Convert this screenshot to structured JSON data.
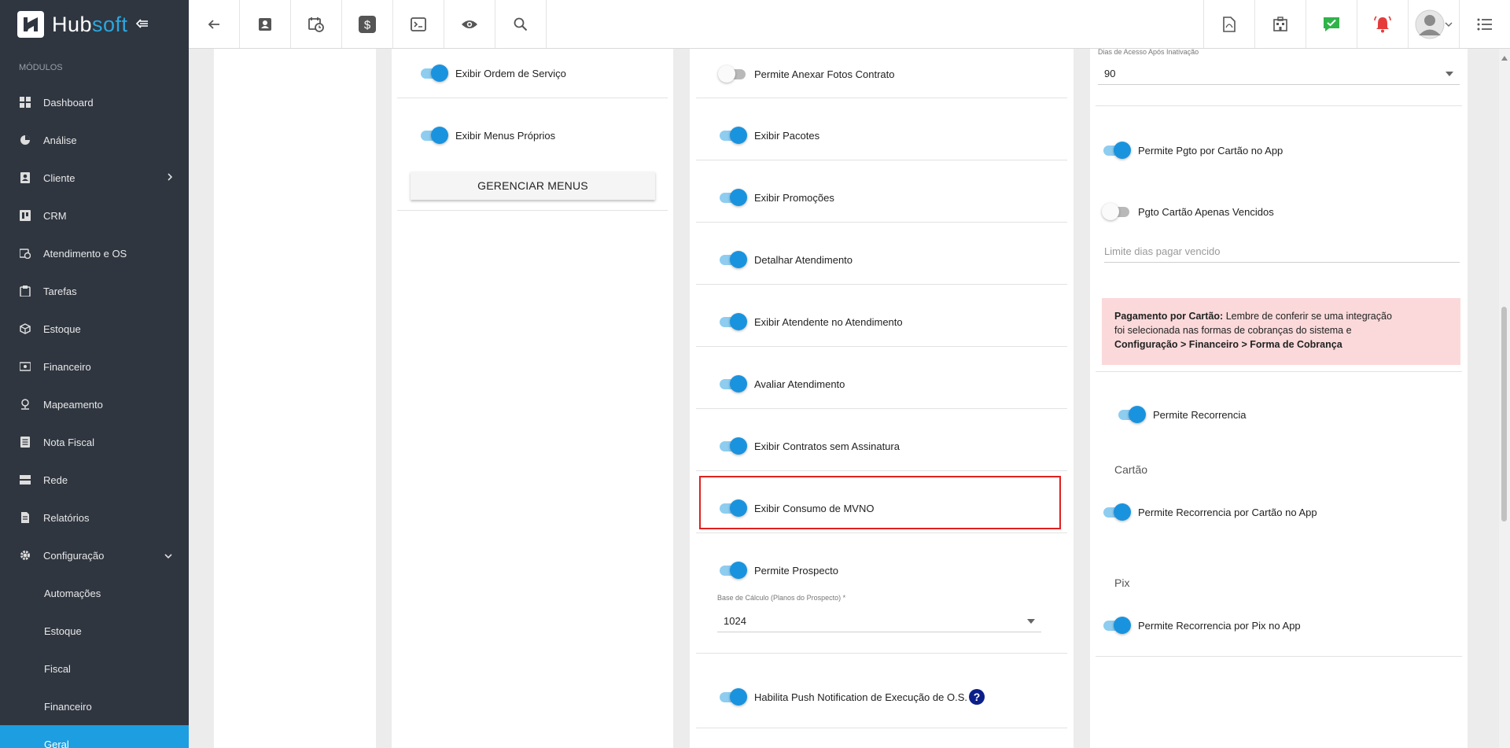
{
  "app": {
    "brand_a": "Hub",
    "brand_b": "soft"
  },
  "sidebar": {
    "section": "MÓDULOS",
    "items": [
      {
        "label": "Dashboard",
        "icon": "dashboard-icon"
      },
      {
        "label": "Análise",
        "icon": "pie-chart-icon"
      },
      {
        "label": "Cliente",
        "icon": "contact-icon"
      },
      {
        "label": "CRM",
        "icon": "board-icon"
      },
      {
        "label": "Atendimento e OS",
        "icon": "calendar-clock-icon"
      },
      {
        "label": "Tarefas",
        "icon": "clipboard-icon"
      },
      {
        "label": "Estoque",
        "icon": "box-icon"
      },
      {
        "label": "Financeiro",
        "icon": "money-icon"
      },
      {
        "label": "Mapeamento",
        "icon": "map-pin-icon"
      },
      {
        "label": "Nota Fiscal",
        "icon": "receipt-icon"
      },
      {
        "label": "Rede",
        "icon": "server-icon"
      },
      {
        "label": "Relatórios",
        "icon": "document-icon"
      },
      {
        "label": "Configuração",
        "icon": "gear-icon"
      }
    ],
    "sub_items": [
      {
        "label": "Automações"
      },
      {
        "label": "Estoque"
      },
      {
        "label": "Fiscal"
      },
      {
        "label": "Financeiro"
      },
      {
        "label": "Geral"
      }
    ]
  },
  "col2": {
    "toggles": [
      {
        "label": "Exibir Ordem de Serviço",
        "on": true
      },
      {
        "label": "Exibir Menus Próprios",
        "on": true
      }
    ],
    "manage_button": "GERENCIAR MENUS"
  },
  "col3": {
    "toggles": [
      {
        "label": "Permite Anexar Fotos Contrato",
        "on": false
      },
      {
        "label": "Exibir Pacotes",
        "on": true
      },
      {
        "label": "Exibir Promoções",
        "on": true
      },
      {
        "label": "Detalhar Atendimento",
        "on": true
      },
      {
        "label": "Exibir Atendente no Atendimento",
        "on": true
      },
      {
        "label": "Avaliar Atendimento",
        "on": true
      },
      {
        "label": "Exibir Contratos sem Assinatura",
        "on": true
      },
      {
        "label": "Exibir Consumo de MVNO",
        "on": true
      },
      {
        "label": "Permite Prospecto",
        "on": true
      },
      {
        "label": "Habilita Push Notification de Execução de O.S.",
        "on": true
      }
    ],
    "base_calc_label": "Base de Cálculo (Planos do Prospecto) *",
    "base_calc_value": "1024",
    "help_glyph": "?"
  },
  "col4": {
    "days_label": "Dias de Acesso Após Inativação",
    "days_value": "90",
    "toggles": [
      {
        "label": "Permite Pgto por Cartão no App",
        "on": true
      },
      {
        "label": "Pgto Cartão Apenas Vencidos",
        "on": false
      },
      {
        "label": "Permite Recorrencia",
        "on": true
      },
      {
        "label": "Permite Recorrencia por Cartão no App",
        "on": true
      },
      {
        "label": "Permite Recorrencia por Pix no App",
        "on": true
      }
    ],
    "limit_placeholder": "Limite dias pagar vencido",
    "alert": {
      "title": "Pagamento por Cartão:",
      "line1": " Lembre de conferir se uma integração",
      "line2": "foi selecionada nas formas de cobranças do sistema e",
      "line3": "Configuração > Financeiro > Forma de Cobrança"
    },
    "card_head": "Cartão",
    "pix_head": "Pix"
  },
  "colors": {
    "accent": "#1c9ee0",
    "sidebar": "#2f3640",
    "alert_bg": "#fbd9da",
    "highlight": "#e02020"
  }
}
